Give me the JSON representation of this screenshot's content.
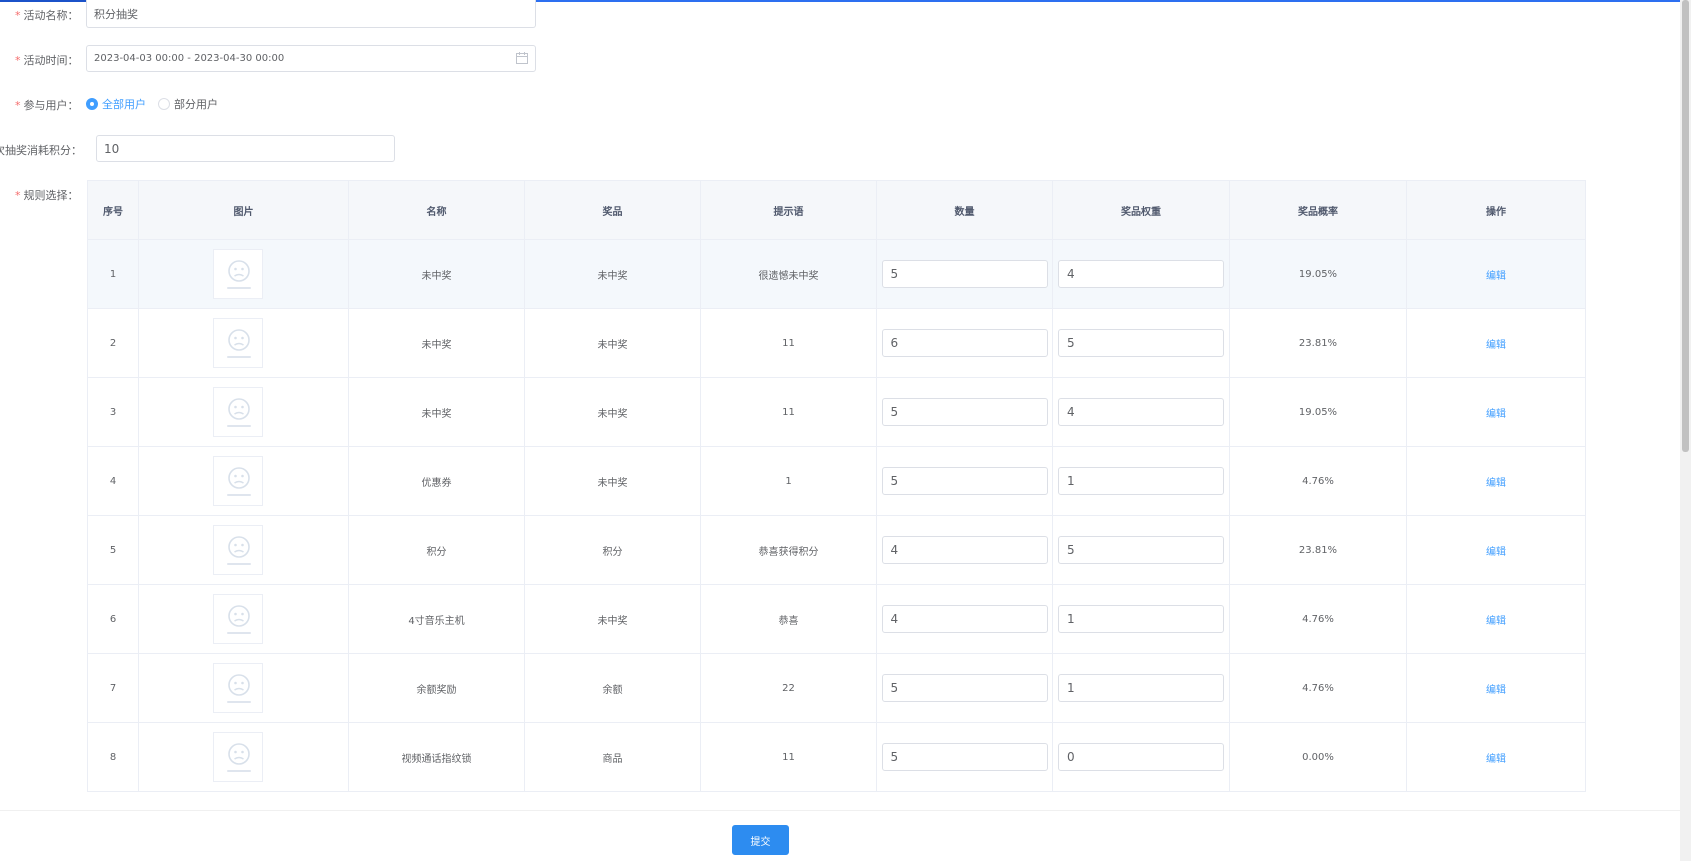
{
  "form": {
    "activity_name": {
      "label": "活动名称：",
      "value": "积分抽奖"
    },
    "activity_time": {
      "label": "活动时间：",
      "value": "2023-04-03 00:00 - 2023-04-30 00:00"
    },
    "participants": {
      "label": "参与用户：",
      "options": [
        {
          "label": "全部用户",
          "checked": true
        },
        {
          "label": "部分用户",
          "checked": false
        }
      ]
    },
    "points_cost": {
      "label": "次抽奖消耗积分：",
      "value": "10"
    },
    "rules_label": "规则选择："
  },
  "table": {
    "headers": [
      "序号",
      "图片",
      "名称",
      "奖品",
      "提示语",
      "数量",
      "奖品权重",
      "奖品概率",
      "操作"
    ],
    "placeholder_icon": "sad-face-image-placeholder-icon",
    "rows": [
      {
        "index": "1",
        "name": "未中奖",
        "prize": "未中奖",
        "tip": "很遗憾未中奖",
        "qty": "5",
        "weight": "4",
        "prob": "19.05%",
        "action": "编辑"
      },
      {
        "index": "2",
        "name": "未中奖",
        "prize": "未中奖",
        "tip": "11",
        "qty": "6",
        "weight": "5",
        "prob": "23.81%",
        "action": "编辑"
      },
      {
        "index": "3",
        "name": "未中奖",
        "prize": "未中奖",
        "tip": "11",
        "qty": "5",
        "weight": "4",
        "prob": "19.05%",
        "action": "编辑"
      },
      {
        "index": "4",
        "name": "优惠券",
        "prize": "未中奖",
        "tip": "1",
        "qty": "5",
        "weight": "1",
        "prob": "4.76%",
        "action": "编辑"
      },
      {
        "index": "5",
        "name": "积分",
        "prize": "积分",
        "tip": "恭喜获得积分",
        "qty": "4",
        "weight": "5",
        "prob": "23.81%",
        "action": "编辑"
      },
      {
        "index": "6",
        "name": "4寸音乐主机",
        "prize": "未中奖",
        "tip": "恭喜",
        "qty": "4",
        "weight": "1",
        "prob": "4.76%",
        "action": "编辑"
      },
      {
        "index": "7",
        "name": "余额奖励",
        "prize": "余额",
        "tip": "22",
        "qty": "5",
        "weight": "1",
        "prob": "4.76%",
        "action": "编辑"
      },
      {
        "index": "8",
        "name": "视频通话指纹锁",
        "prize": "商品",
        "tip": "11",
        "qty": "5",
        "weight": "0",
        "prob": "0.00%",
        "action": "编辑"
      }
    ]
  },
  "submit_label": "提交",
  "colors": {
    "primary": "#2d8cf0",
    "required": "#f56c6c",
    "link": "#409eff"
  }
}
